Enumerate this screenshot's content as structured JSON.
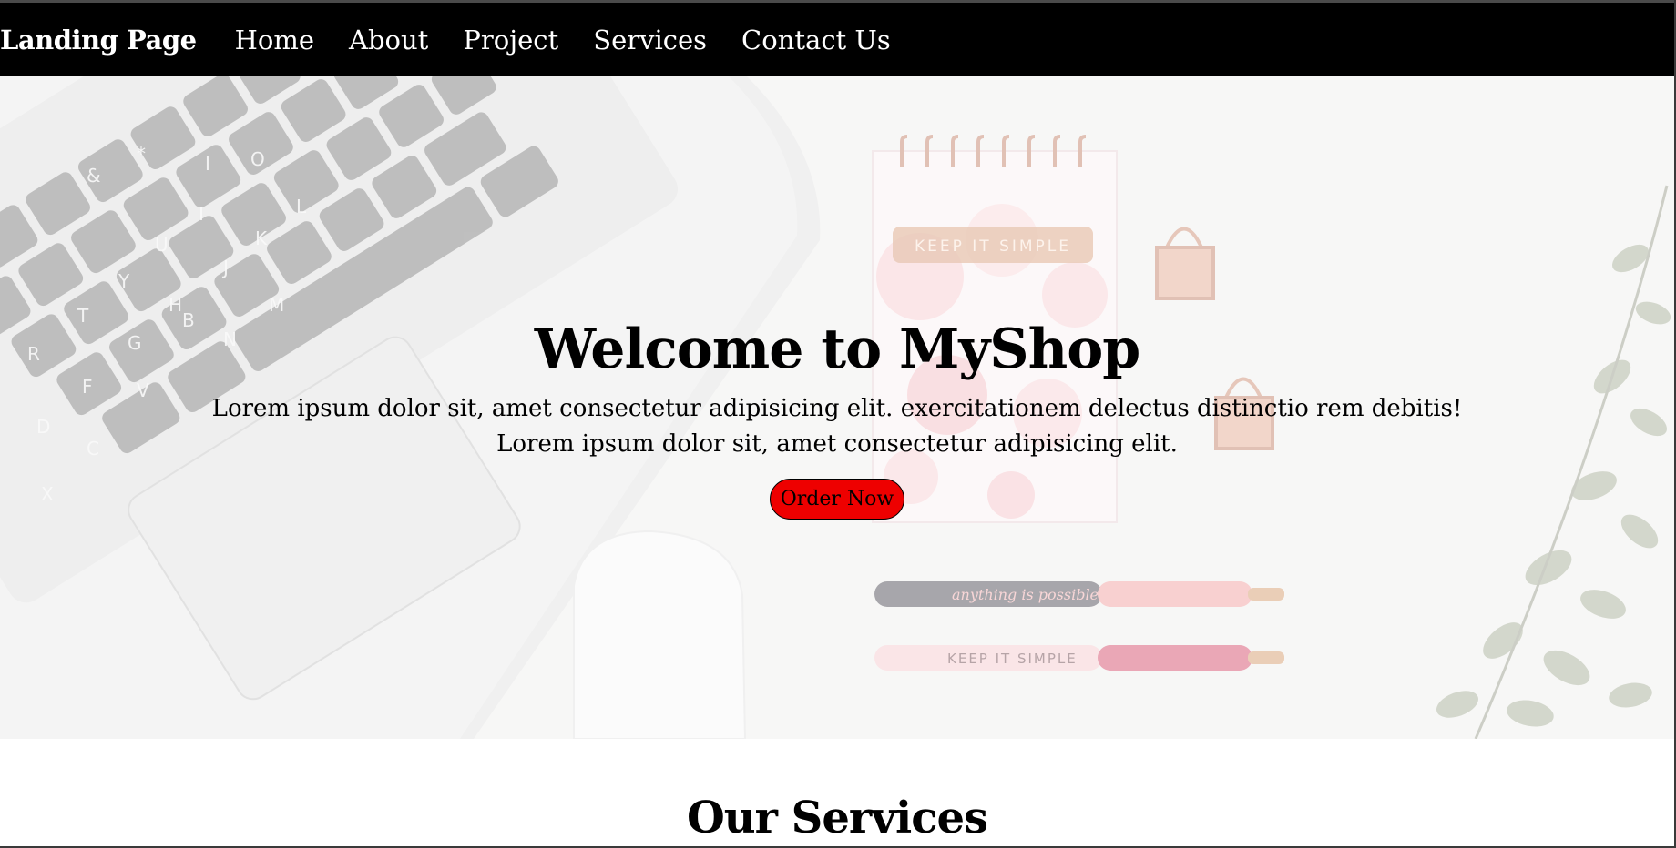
{
  "nav": {
    "brand": "Landing Page",
    "links": [
      "Home",
      "About",
      "Project",
      "Services",
      "Contact Us"
    ]
  },
  "hero": {
    "title": "Welcome to MyShop",
    "line1": "Lorem ipsum dolor sit, amet consectetur adipisicing elit. exercitationem delectus distinctio rem debitis!",
    "line2": "Lorem ipsum dolor sit, amet consectetur adipisicing elit.",
    "button_label": "Order Now",
    "notepad_text": "KEEP IT SIMPLE",
    "pen1_text": "anything is possible",
    "pen2_text": "KEEP IT SIMPLE",
    "button_color": "#ee0000"
  },
  "services": {
    "title": "Our Services"
  }
}
